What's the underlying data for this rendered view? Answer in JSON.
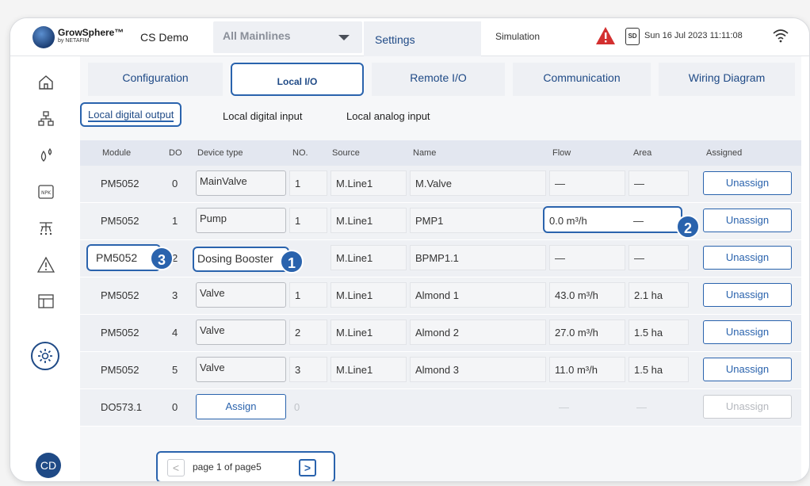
{
  "app": {
    "brand": "GrowSphere™",
    "brand_sub": "by NETAFIM"
  },
  "topbar": {
    "farm": "CS Demo",
    "mainline": "All Mainlines",
    "settings": "Settings",
    "mode": "Simulation",
    "sd": "SD",
    "datetime": "Sun 16 Jul 2023  11:11:08"
  },
  "user": {
    "initials": "CD"
  },
  "tabs": [
    "Configuration",
    "Local I/O",
    "Remote  I/O",
    "Communication",
    "Wiring Diagram"
  ],
  "io_tabs": [
    "Local digital output",
    "Local digital input",
    "Local analog input"
  ],
  "columns": [
    "Module",
    "DO",
    "Device type",
    "NO.",
    "Source",
    "Name",
    "Flow",
    "Area",
    "Assigned"
  ],
  "rows": [
    {
      "module": "PM5052",
      "do": "0",
      "device": "MainValve",
      "no": "1",
      "source": "M.Line1",
      "name": "M.Valve",
      "flow": "—",
      "area": "—",
      "action": "Unassign"
    },
    {
      "module": "PM5052",
      "do": "1",
      "device": "Pump",
      "no": "1",
      "source": "M.Line1",
      "name": "PMP1",
      "flow": "0.0 m³/h",
      "area": "—",
      "action": "Unassign"
    },
    {
      "module": "PM5052",
      "do": "2",
      "device": "Dosing Booster",
      "no": "",
      "source": "M.Line1",
      "name": "BPMP1.1",
      "flow": "—",
      "area": "—",
      "action": "Unassign"
    },
    {
      "module": "PM5052",
      "do": "3",
      "device": "Valve",
      "no": "1",
      "source": "M.Line1",
      "name": "Almond 1",
      "flow": "43.0 m³/h",
      "area": "2.1 ha",
      "action": "Unassign"
    },
    {
      "module": "PM5052",
      "do": "4",
      "device": "Valve",
      "no": "2",
      "source": "M.Line1",
      "name": "Almond 2",
      "flow": "27.0 m³/h",
      "area": "1.5 ha",
      "action": "Unassign"
    },
    {
      "module": "PM5052",
      "do": "5",
      "device": "Valve",
      "no": "3",
      "source": "M.Line1",
      "name": "Almond 3",
      "flow": "11.0 m³/h",
      "area": "1.5 ha",
      "action": "Unassign"
    },
    {
      "module": "DO573.1",
      "do": "0",
      "device": "Assign",
      "no": "0",
      "source": "",
      "name": "",
      "flow": "—",
      "area": "—",
      "action": "Unassign"
    }
  ],
  "badges": [
    "1",
    "2",
    "3"
  ],
  "pager": {
    "text": "page 1 of page5",
    "prev": "<",
    "next": ">"
  },
  "colors": {
    "accent": "#2a63ad",
    "alert": "#d32f2f"
  }
}
